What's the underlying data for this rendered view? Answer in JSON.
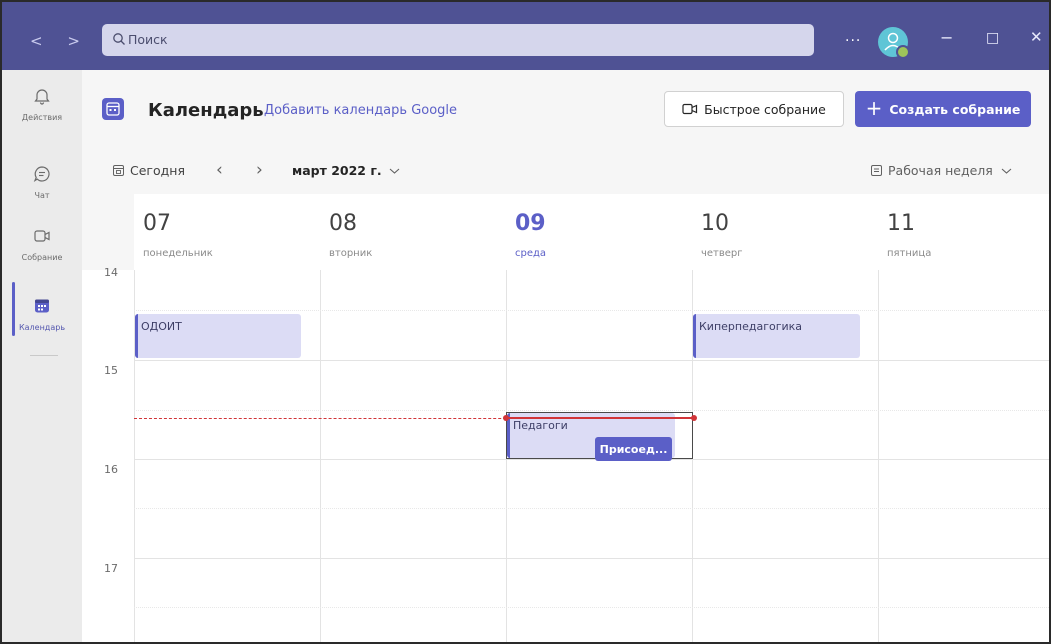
{
  "titlebar": {
    "nav_arrows": "< >",
    "search_placeholder": "Поиск",
    "more": "···",
    "minimize": "−",
    "maximize": "□",
    "close": "✕"
  },
  "rail": {
    "items": [
      {
        "label": "Действия",
        "icon": "bell-icon"
      },
      {
        "label": "Чат",
        "icon": "chat-icon"
      },
      {
        "label": "Собрание",
        "icon": "video-icon"
      },
      {
        "label": "Календарь",
        "icon": "calendar-icon",
        "active": true
      }
    ]
  },
  "header": {
    "title": "Календарь",
    "google_link": "Добавить календарь Google",
    "quick_meeting": "Быстрое собрание",
    "create_meeting": "Создать собрание"
  },
  "toolbar": {
    "today": "Сегодня",
    "month": "март 2022 г.",
    "view": "Рабочая неделя"
  },
  "days": [
    {
      "num": "07",
      "name": "понедельник"
    },
    {
      "num": "08",
      "name": "вторник"
    },
    {
      "num": "09",
      "name": "среда",
      "today": true
    },
    {
      "num": "10",
      "name": "четверг"
    },
    {
      "num": "11",
      "name": "пятница"
    }
  ],
  "hours": [
    "14",
    "15",
    "16",
    "17"
  ],
  "events": [
    {
      "title": "ОДОИТ",
      "day": "07"
    },
    {
      "title": "Киперпедагогика",
      "day": "10"
    },
    {
      "title": "Педагоги",
      "day": "09",
      "join": "Присоед..."
    }
  ],
  "colors": {
    "titlebar": "#4f5294",
    "accent": "#5b5fc7",
    "event_bg": "#dcdcf5",
    "now_line": "#d13438"
  }
}
